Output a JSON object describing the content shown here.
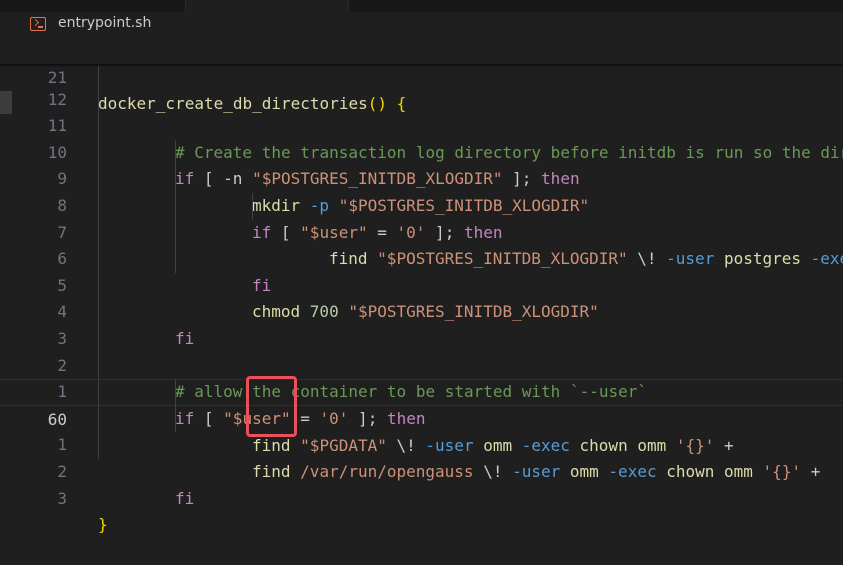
{
  "breadcrumb": {
    "file_name": "entrypoint.sh"
  },
  "sticky": {
    "line_number": "21",
    "function_name": "docker_create_db_directories",
    "parens": "()",
    "brace": "{"
  },
  "lines": [
    {
      "n": "12",
      "text": ""
    },
    {
      "n": "11",
      "c1": "# Create the transaction log directory before initdb is run so the dir"
    },
    {
      "n": "10",
      "a": "if",
      "b": " [ -n ",
      "c": "\"$POSTGRES_INITDB_XLOGDIR\"",
      "d": " ]; ",
      "e": "then"
    },
    {
      "n": "9",
      "a": "mkdir ",
      "b": "-p ",
      "c": "\"$POSTGRES_INITDB_XLOGDIR\""
    },
    {
      "n": "8",
      "a": "if",
      "b": " [ ",
      "c": "\"$user\"",
      "d": " = ",
      "e": "'0'",
      "f": " ]; ",
      "g": "then"
    },
    {
      "n": "7",
      "a": "find ",
      "b": "\"$POSTGRES_INITDB_XLOGDIR\"",
      "c": " \\! ",
      "d": "-user ",
      "e": "postgres ",
      "f": "-exe"
    },
    {
      "n": "6",
      "a": "fi"
    },
    {
      "n": "5",
      "a": "chmod ",
      "b": "700 ",
      "c": "\"$POSTGRES_INITDB_XLOGDIR\""
    },
    {
      "n": "4",
      "a": "fi"
    },
    {
      "n": "3",
      "text": ""
    },
    {
      "n": "2",
      "c1": "# allow the container to be started with `--user`"
    },
    {
      "n": "1",
      "a": "if",
      "b": " [ ",
      "c": "\"$user\"",
      "d": " = ",
      "e": "'0'",
      "f": " ]; ",
      "g": "then"
    },
    {
      "n": "60",
      "a": "find ",
      "b": "\"$PGDATA\"",
      "c": " \\! ",
      "d": "-user ",
      "e": "omm ",
      "f": "-exec ",
      "g": "chown omm ",
      "h": "'{}'",
      "i": " +"
    },
    {
      "n": "1",
      "a": "find ",
      "b": "/var/run/opengauss",
      "c": " \\! ",
      "d": "-user ",
      "e": "omm ",
      "f": "-exec ",
      "g": "chown omm ",
      "h": "'{}'",
      "i": " +"
    },
    {
      "n": "2",
      "a": "fi"
    },
    {
      "n": "3",
      "a": "}"
    }
  ]
}
